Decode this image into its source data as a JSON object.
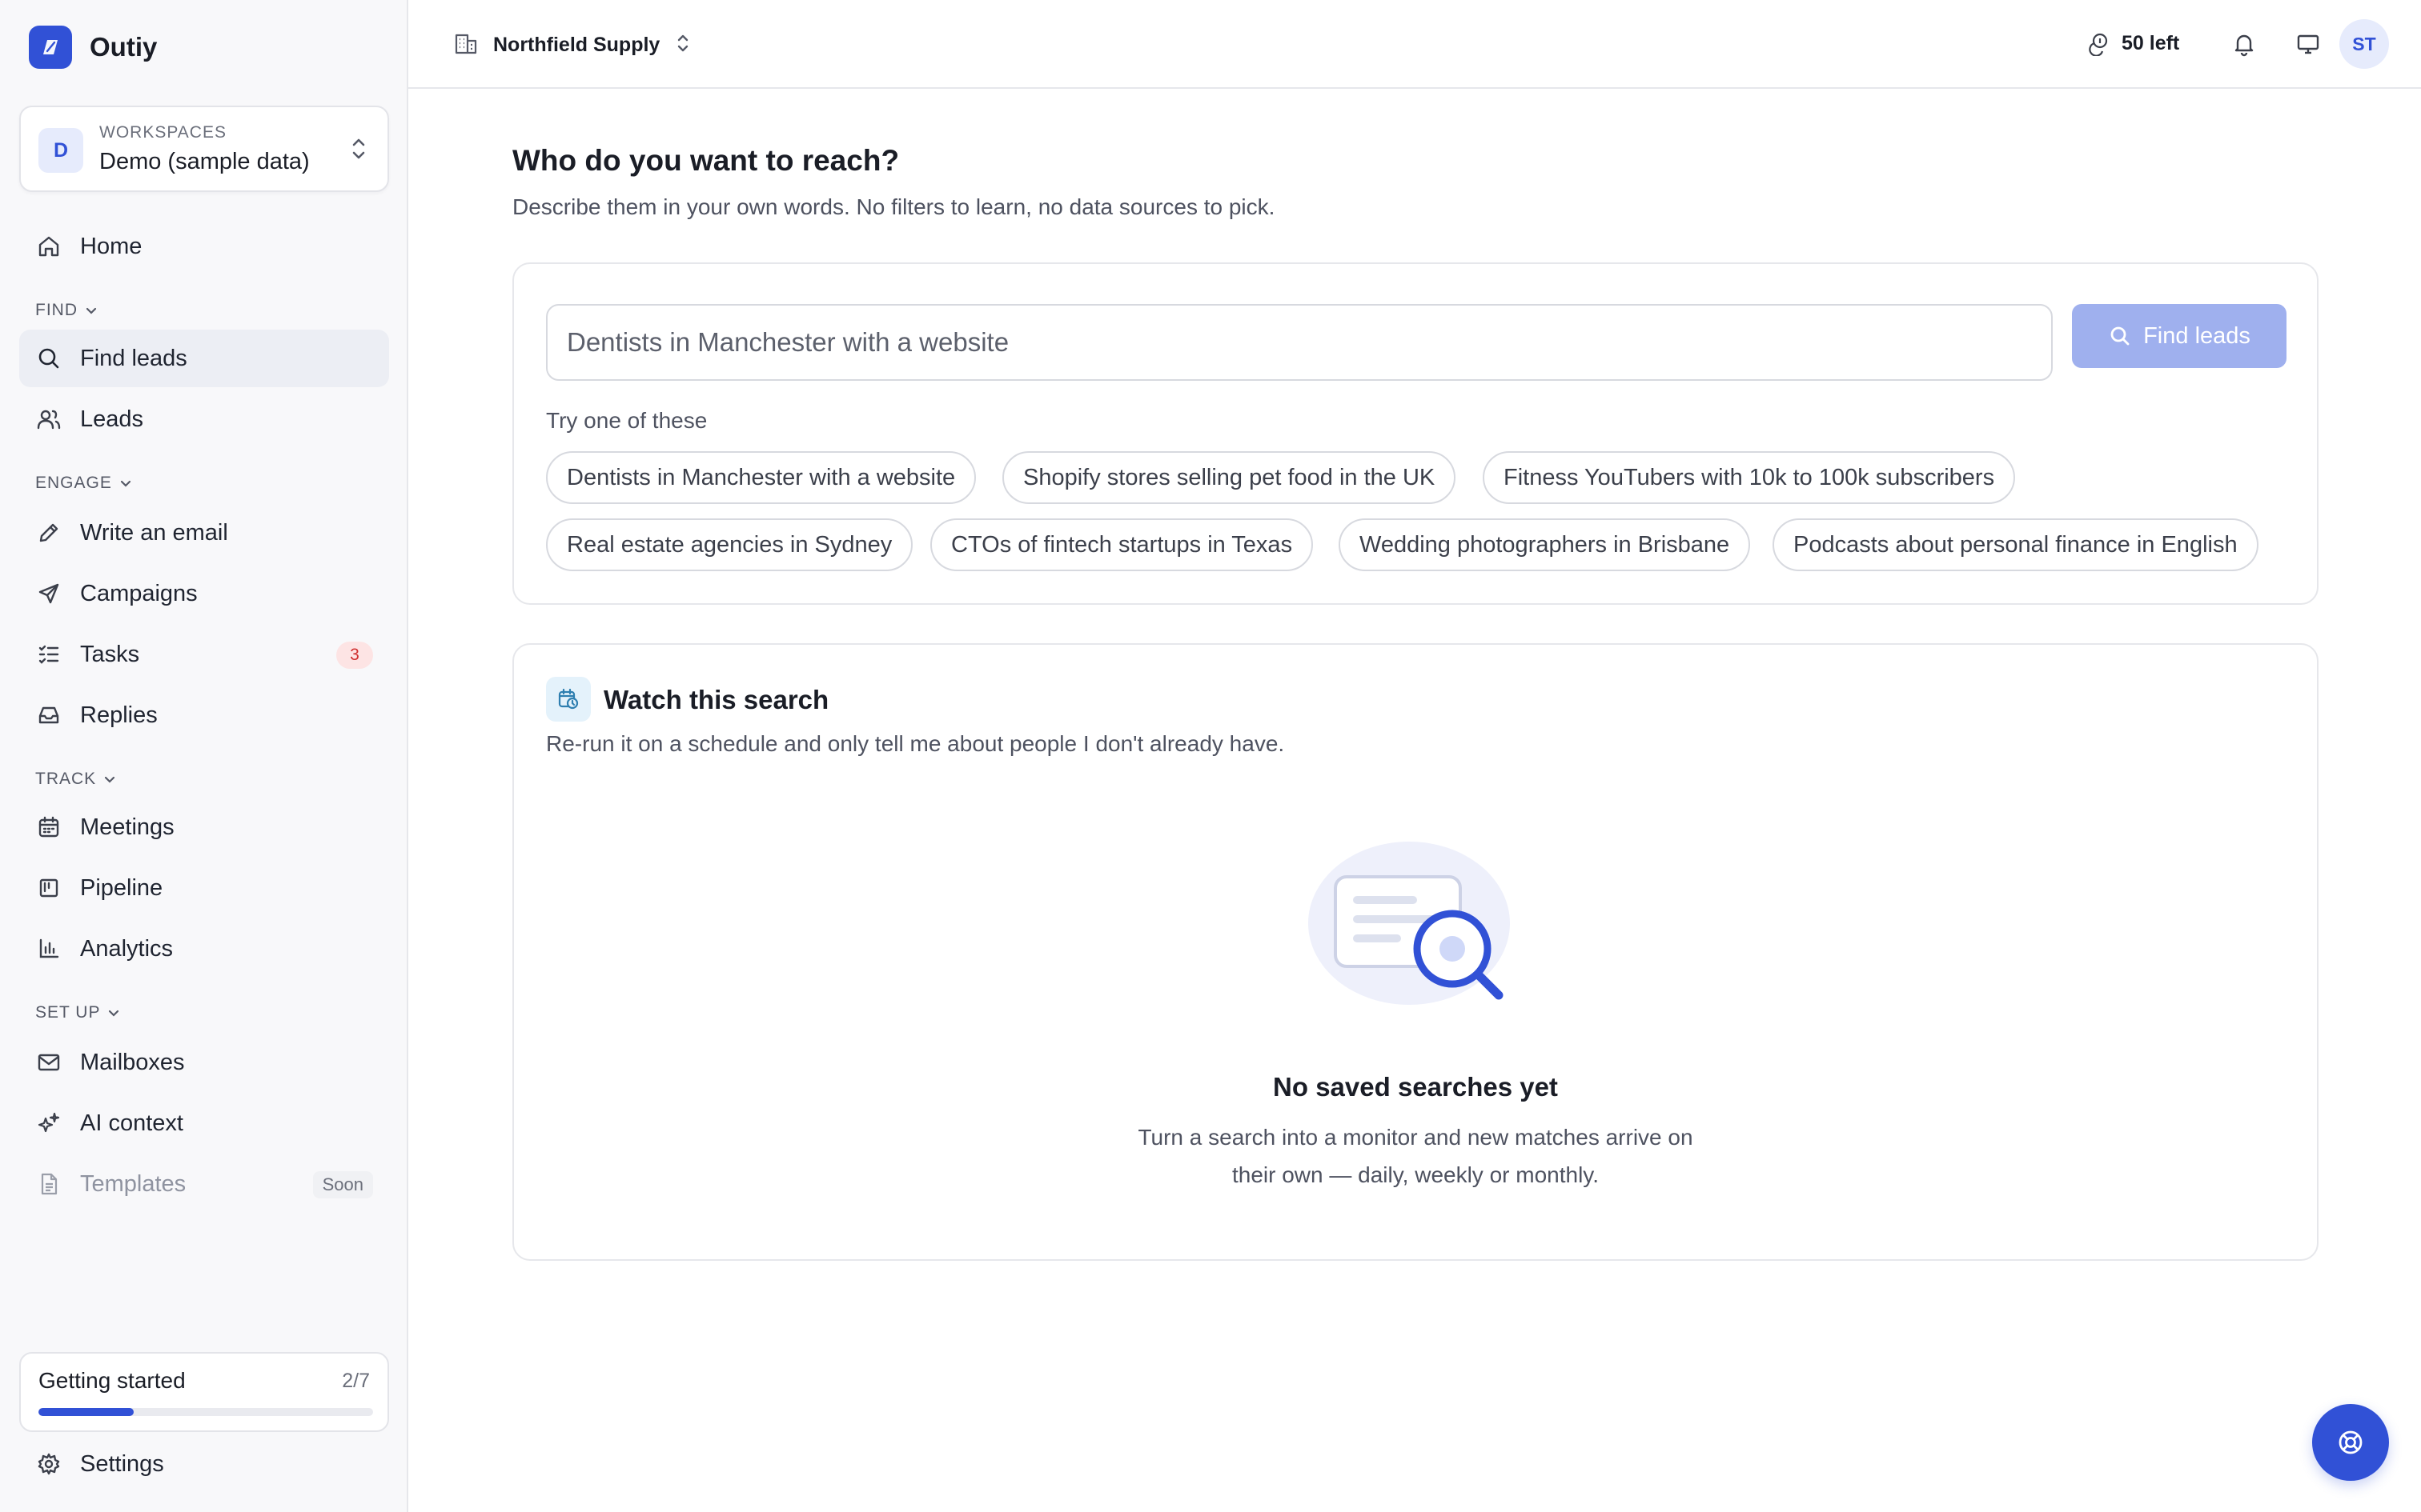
{
  "app": {
    "name": "Outiy"
  },
  "workspace": {
    "label": "WORKSPACES",
    "name": "Demo (sample data)",
    "avatar": "D"
  },
  "sidebar": {
    "home": {
      "label": "Home",
      "icon": "home-icon"
    },
    "sections": {
      "find": "FIND",
      "engage": "ENGAGE",
      "track": "TRACK",
      "setup": "SET UP"
    },
    "find": [
      {
        "label": "Find leads",
        "icon": "search-icon",
        "active": true
      },
      {
        "label": "Leads",
        "icon": "users-icon"
      }
    ],
    "engage": [
      {
        "label": "Write an email",
        "icon": "pen-icon"
      },
      {
        "label": "Campaigns",
        "icon": "send-icon"
      },
      {
        "label": "Tasks",
        "icon": "checklist-icon",
        "badge": "3"
      },
      {
        "label": "Replies",
        "icon": "inbox-icon"
      }
    ],
    "track": [
      {
        "label": "Meetings",
        "icon": "calendar-icon"
      },
      {
        "label": "Pipeline",
        "icon": "kanban-icon"
      },
      {
        "label": "Analytics",
        "icon": "bar-chart-icon"
      }
    ],
    "setup": [
      {
        "label": "Mailboxes",
        "icon": "mail-icon"
      },
      {
        "label": "AI context",
        "icon": "sparkles-icon"
      },
      {
        "label": "Templates",
        "icon": "document-icon",
        "badge": "Soon",
        "disabled": true
      }
    ],
    "getting_started": {
      "title": "Getting started",
      "count": "2/7",
      "progress": 0.2857
    },
    "settings": {
      "label": "Settings",
      "icon": "gear-icon"
    }
  },
  "topbar": {
    "org_name": "Northfield Supply",
    "credits": "50 left",
    "user_initials": "ST"
  },
  "main": {
    "title": "Who do you want to reach?",
    "subtitle": "Describe them in your own words. No filters to learn, no data sources to pick.",
    "search": {
      "placeholder": "Dentists in Manchester with a website",
      "value": "",
      "button": "Find leads"
    },
    "try_label": "Try one of these",
    "suggestions": [
      "Dentists in Manchester with a website",
      "Shopify stores selling pet food in the UK",
      "Fitness YouTubers with 10k to 100k subscribers",
      "Real estate agencies in Sydney",
      "CTOs of fintech startups in Texas",
      "Wedding photographers in Brisbane",
      "Podcasts about personal finance in English"
    ],
    "watch": {
      "title": "Watch this search",
      "subtitle": "Re-run it on a schedule and only tell me about people I don't already have.",
      "empty_title": "No saved searches yet",
      "empty_body": "Turn a search into a monitor and new matches arrive on their own — daily, weekly or monthly."
    }
  },
  "colors": {
    "accent": "#3151d6",
    "accent_light": "#9fb0ee",
    "badge_red": "#cf2f2f",
    "sidebar_bg": "#f8f8fa"
  }
}
